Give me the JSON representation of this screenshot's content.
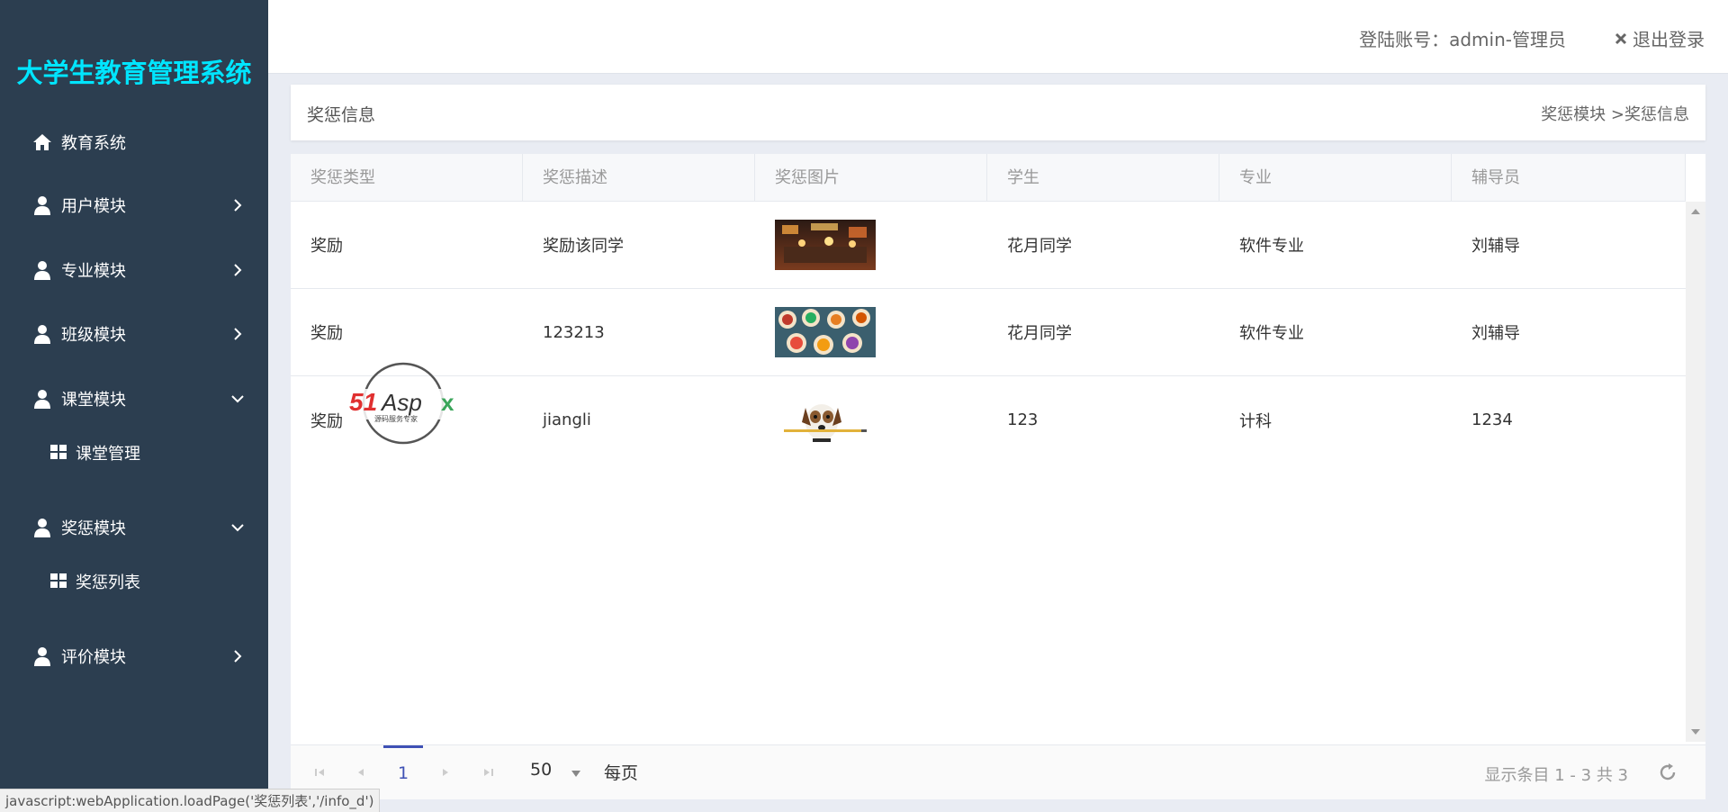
{
  "app": {
    "title": "大学生教育管理系统"
  },
  "sidebar": {
    "items": [
      {
        "label": "教育系统",
        "icon": "home-icon",
        "expanded": false
      },
      {
        "label": "用户模块",
        "icon": "user-icon",
        "expanded": false
      },
      {
        "label": "专业模块",
        "icon": "user-icon",
        "expanded": false
      },
      {
        "label": "班级模块",
        "icon": "user-icon",
        "expanded": false
      },
      {
        "label": "课堂模块",
        "icon": "user-icon",
        "expanded": true
      },
      {
        "label": "奖惩模块",
        "icon": "user-icon",
        "expanded": true
      },
      {
        "label": "评价模块",
        "icon": "user-icon",
        "expanded": false
      }
    ],
    "subitems": {
      "class": "课堂管理",
      "reward": "奖惩列表"
    }
  },
  "topbar": {
    "account": "登陆账号：admin-管理员",
    "logout": "退出登录"
  },
  "panel": {
    "title": "奖惩信息",
    "breadcrumb": "奖惩模块 >奖惩信息"
  },
  "table": {
    "columns": [
      "奖惩类型",
      "奖惩描述",
      "奖惩图片",
      "学生",
      "专业",
      "辅导员"
    ],
    "rows": [
      {
        "type": "奖励",
        "desc": "奖励该同学",
        "image": "restaurant-photo",
        "student": "花月同学",
        "major": "软件专业",
        "counselor": "刘辅导"
      },
      {
        "type": "奖励",
        "desc": "123213",
        "image": "food-dishes-photo",
        "student": "花月同学",
        "major": "软件专业",
        "counselor": "刘辅导"
      },
      {
        "type": "奖励",
        "desc": "jiangli",
        "image": "dog-with-pencil-photo",
        "student": "123",
        "major": "计科",
        "counselor": "1234"
      }
    ]
  },
  "pager": {
    "current_page": "1",
    "page_size": "50",
    "per_page_label": "每页",
    "info": "显示条目 1 - 3 共 3"
  },
  "watermark": {
    "brand": "51Aspx",
    "tagline": "源码服务专家"
  },
  "statusbar": {
    "text": "javascript:webApplication.loadPage('奖惩列表','/info_d')"
  },
  "colors": {
    "sidebar": "#2c3e50",
    "brand_text": "#00e5ff",
    "accent": "#3f51b5"
  }
}
